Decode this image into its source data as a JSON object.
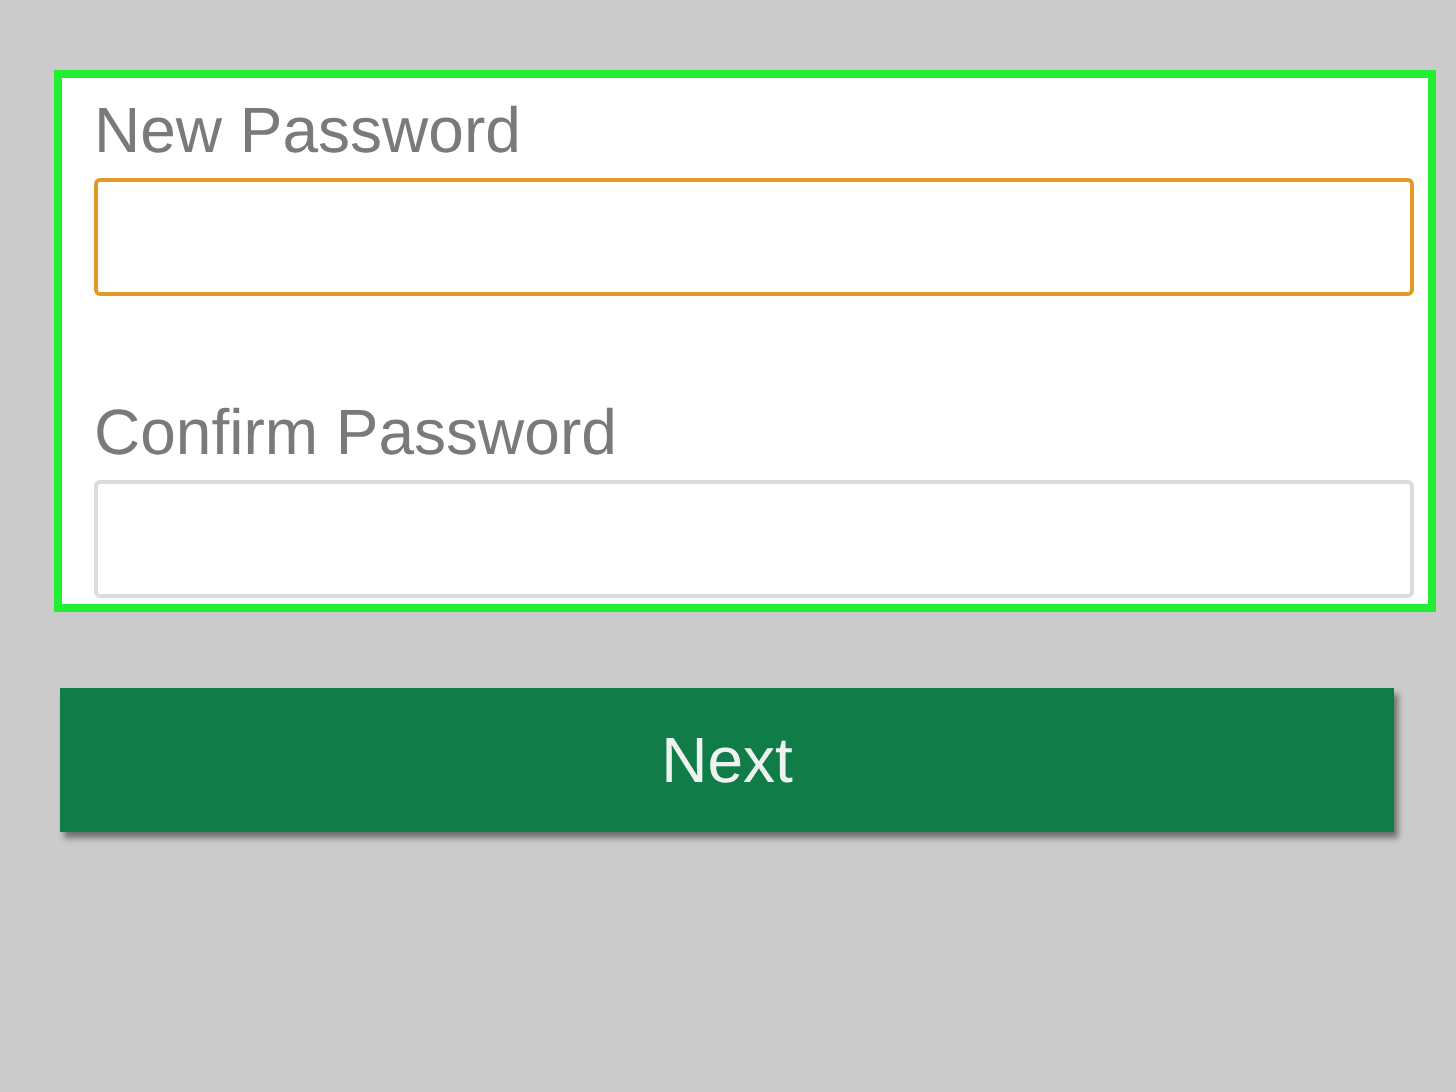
{
  "fields": [
    {
      "label": "New Password",
      "focused": true
    },
    {
      "label": "Confirm Password",
      "focused": false
    }
  ],
  "next_button": {
    "label": "Next"
  }
}
